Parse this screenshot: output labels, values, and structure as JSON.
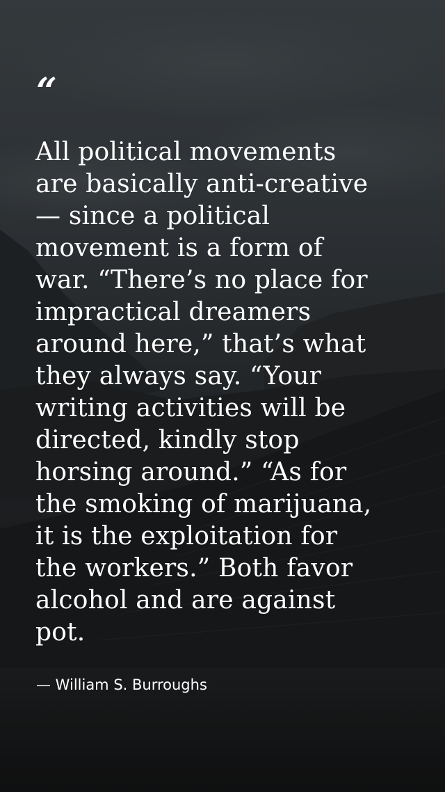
{
  "quote": {
    "mark": "“",
    "lines": [
      "All political movements",
      "are basically anti-creative",
      "— since a political",
      "movement is a form of",
      "war. “There’s no place for",
      "impractical dreamers",
      "around here,” that’s what",
      "they always say. “Your",
      "writing activities will be",
      "directed, kindly stop",
      "horsing around.” “As for",
      "the smoking of marijuana,",
      "it is the exploitation for",
      "the workers.” Both favor",
      "alcohol and are against",
      "pot."
    ],
    "attribution": "— William S. Burroughs"
  },
  "colors": {
    "text": "#ffffff",
    "background": "#1c1e20"
  }
}
